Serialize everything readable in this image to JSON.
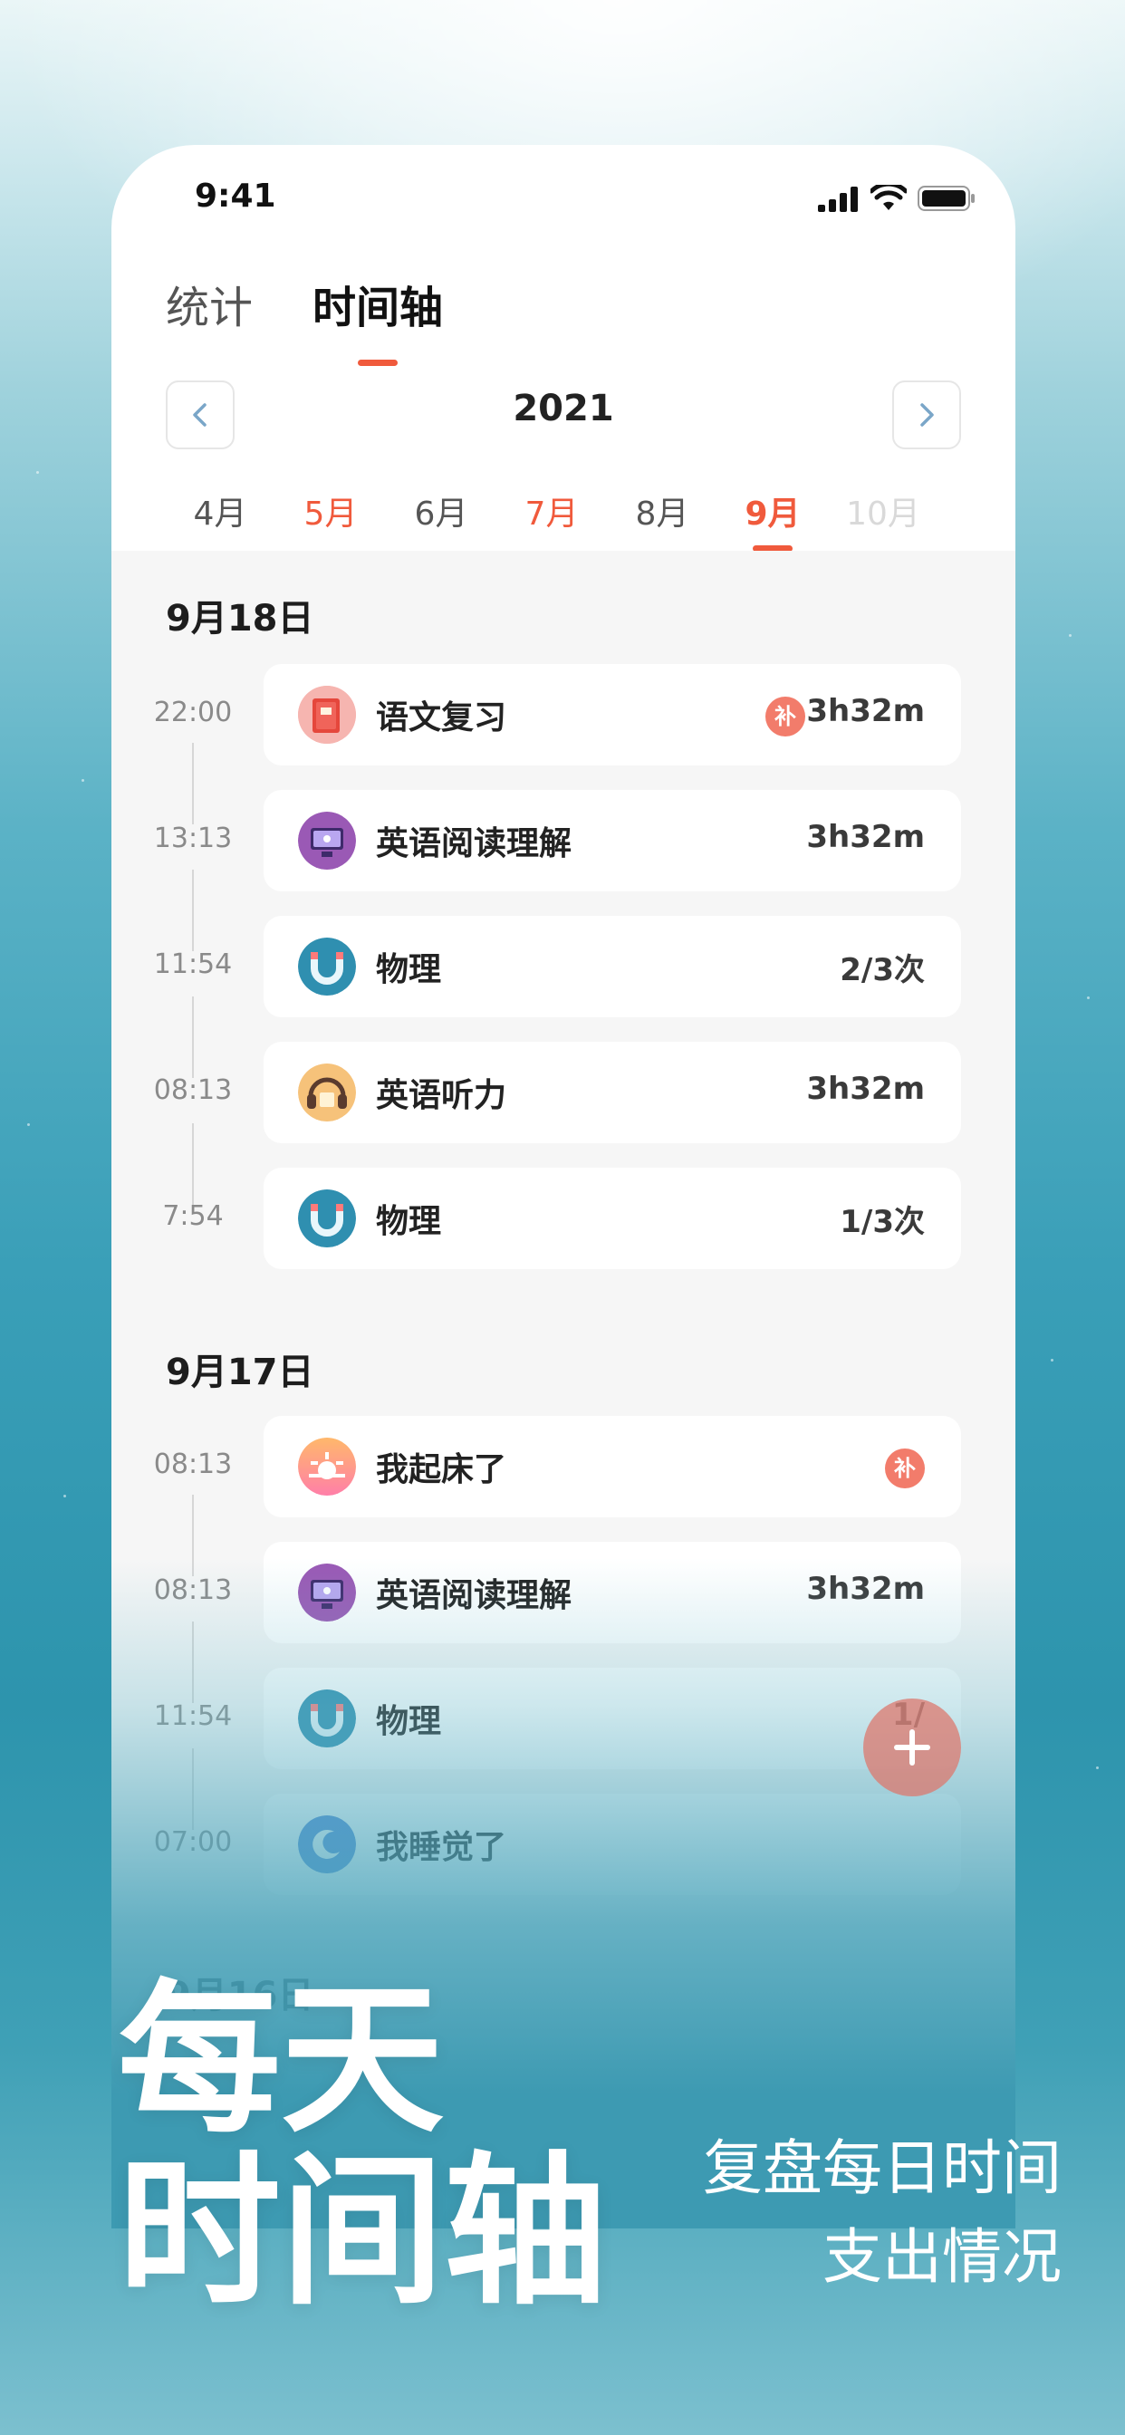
{
  "status": {
    "time": "9:41"
  },
  "tabs": [
    {
      "label": "统计"
    },
    {
      "label": "时间轴"
    }
  ],
  "year": "2021",
  "months": [
    "4月",
    "5月",
    "6月",
    "7月",
    "8月",
    "9月",
    "10月"
  ],
  "days": [
    {
      "title": "9月18日",
      "entries": [
        {
          "time": "22:00",
          "name": "语文复习",
          "value": "3h32m",
          "badge": "补",
          "icon": "red-book-icon"
        },
        {
          "time": "13:13",
          "name": "英语阅读理解",
          "value": "3h32m",
          "icon": "monitor-icon"
        },
        {
          "time": "11:54",
          "name": "物理",
          "value": "2/3次",
          "icon": "magnet-icon"
        },
        {
          "time": "08:13",
          "name": "英语听力",
          "value": "3h32m",
          "icon": "headphones-icon"
        },
        {
          "time": "7:54",
          "name": "物理",
          "value": "1/3次",
          "icon": "magnet-icon"
        }
      ]
    },
    {
      "title": "9月17日",
      "entries": [
        {
          "time": "08:13",
          "name": "我起床了",
          "value": "",
          "badge": "补",
          "icon": "sunrise-icon"
        },
        {
          "time": "08:13",
          "name": "英语阅读理解",
          "value": "3h32m",
          "icon": "monitor-icon"
        },
        {
          "time": "11:54",
          "name": "物理",
          "value": "1/",
          "icon": "magnet-icon"
        },
        {
          "time": "07:00",
          "name": "我睡觉了",
          "value": "",
          "icon": "moon-icon"
        }
      ]
    },
    {
      "title": "9月16日"
    }
  ],
  "promo": {
    "headline_line1": "每天",
    "headline_line2": "时间轴",
    "sub_line1": "复盘每日时间",
    "sub_line2": "支出情况"
  }
}
